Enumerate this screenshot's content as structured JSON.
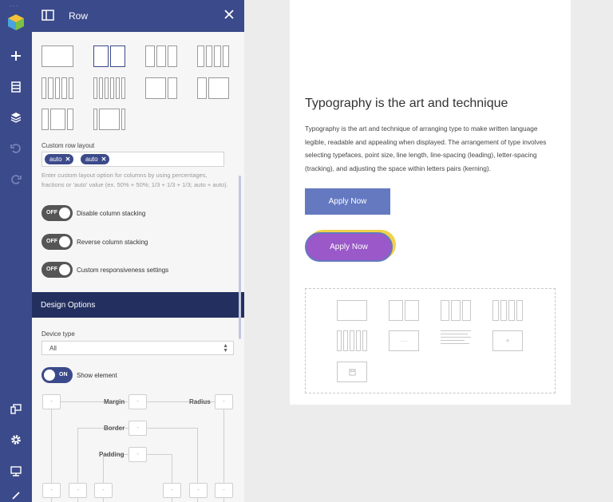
{
  "panel": {
    "title": "Row",
    "custom_row_layout_label": "Custom row layout",
    "layout_tags": [
      "auto",
      "auto"
    ],
    "helper_text": "Enter custom layout option for columns by using percentages, fractions or 'auto' value (ex. 50% + 50%; 1/3 + 1/3 + 1/3; auto + auto).",
    "toggles": [
      {
        "state": "OFF",
        "label": "Disable column stacking"
      },
      {
        "state": "OFF",
        "label": "Reverse column stacking"
      },
      {
        "state": "OFF",
        "label": "Custom responsiveness settings"
      }
    ],
    "design_section_title": "Design Options",
    "device_type_label": "Device type",
    "device_type_value": "All",
    "show_element": {
      "state": "ON",
      "label": "Show element"
    },
    "box_model": {
      "margin_label": "Margin",
      "radius_label": "Radius",
      "border_label": "Border",
      "padding_label": "Padding",
      "placeholder": "-"
    }
  },
  "page": {
    "heading": "Typography is the art and technique",
    "paragraph": "Typography is the art and technique of arranging type to make written language legible, readable and appealing when displayed. The arrangement of type involves selecting typefaces, point size, line length, line-spacing (leading), letter-spacing (tracking), and adjusting the space within letters pairs (kerning).",
    "button_primary": "Apply Now",
    "button_secondary": "Apply Now",
    "element_placeholder": "···"
  },
  "colors": {
    "rail": "#3b4a8a",
    "section_bar": "#23305f",
    "button_primary": "#6479c0",
    "button_secondary": "#9a58c8",
    "button_accent": "#f0d24a"
  },
  "icons": [
    "logo-icon",
    "add-icon",
    "layout-icon",
    "layers-icon",
    "undo-icon",
    "redo-icon",
    "responsive-icon",
    "gear-icon",
    "publish-icon",
    "collapse-icon",
    "panel-icon",
    "close-icon"
  ]
}
